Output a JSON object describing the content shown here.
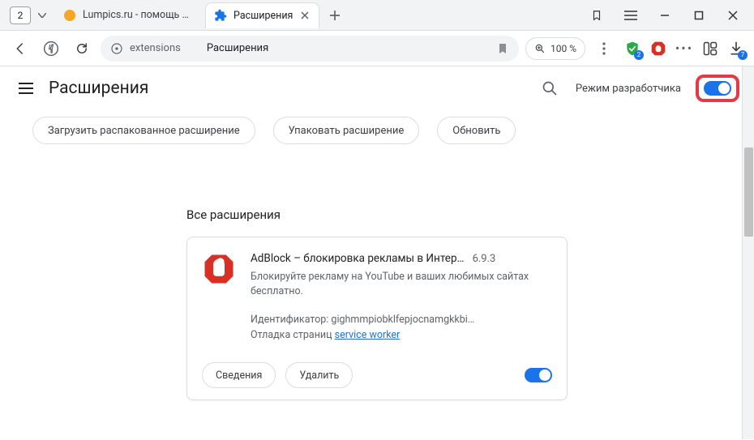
{
  "titlebar": {
    "tab_count": "2",
    "tabs": [
      {
        "label": "Lumpics.ru - помощь с ком",
        "active": false
      },
      {
        "label": "Расширения",
        "active": true
      }
    ]
  },
  "toolbar": {
    "address_host": "extensions",
    "address_title": "Расширения",
    "zoom": "100 %",
    "download_badge": "7"
  },
  "page": {
    "title": "Расширения",
    "dev_mode_label": "Режим разработчика",
    "actions": {
      "load_unpacked": "Загрузить распакованное расширение",
      "pack": "Упаковать расширение",
      "update": "Обновить"
    },
    "section_title": "Все расширения"
  },
  "extension": {
    "name": "AdBlock – блокировка рекламы в Интер…",
    "version": "6.9.3",
    "description": "Блокируйте рекламу на YouTube и ваших любимых сайтах бесплатно.",
    "id_label": "Идентификатор: gighmmpiobklfepjocnamgkkbi…",
    "debug_label": "Отладка страниц ",
    "debug_link": "service worker",
    "details_btn": "Сведения",
    "remove_btn": "Удалить"
  }
}
